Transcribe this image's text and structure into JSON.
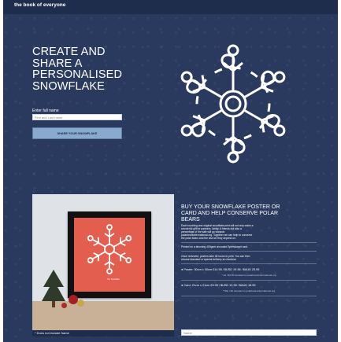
{
  "brand": "the book of everyone",
  "hero": {
    "title": "CREATE AND\nSHARE A\nPERSONALISED\nSNOWFLAKE",
    "name_label": "Enter full name",
    "name_placeholder": "First and Last name",
    "share_button": "SHARE YOUR SNOWFLAKE"
  },
  "poster": {
    "caption": "The Snowflake",
    "note": "* Does not include frame"
  },
  "buy": {
    "title": "BUY YOUR SNOWFLAKE POSTER OR\nCARD AND HELP CONSERVE POLAR\nBEARS",
    "para1_line1": "Each touching and original snowflake print will not only make a",
    "para1_line2": "wonderful gift for partners, family & friends but also a",
    "para1_line3": "percentage of the sale will go towards",
    "para1_line4": "polarbearsinternational.org. Together we can help to conserve",
    "para1_line5": "the polar bears and the sea ice they depend on.",
    "para2": "Printed on a stunning 400gsm uncoated Splendorgel card.",
    "para3_line1": "Once reviewed, posters take 48 hours to print. You can then",
    "para3_line2": "choose standard or special delivery at checkout.",
    "option1": "Poster: 30cm x 30cm £14.95 / $USD 19.95 / $AUD 25.95",
    "option1_sub": "* £1 / $1.50 donated to polarbearsinternational.org",
    "option2": "Card: 21cm x 21cm £9.95 / $USD 12.95 / $AUD 18.95",
    "option2_sub": "* 50p / $1 donated to polarbearsinternational.org",
    "name_placeholder": "Name"
  },
  "colors": {
    "background": "#2a3a5e",
    "topbar": "#1f2d4d",
    "button": "#8aa9cf",
    "poster_red": "#e35e4e"
  },
  "icons": {
    "snowflake": "snowflake-icon",
    "tree": "christmas-tree-icon",
    "bullet": "radio-bullet-icon"
  }
}
